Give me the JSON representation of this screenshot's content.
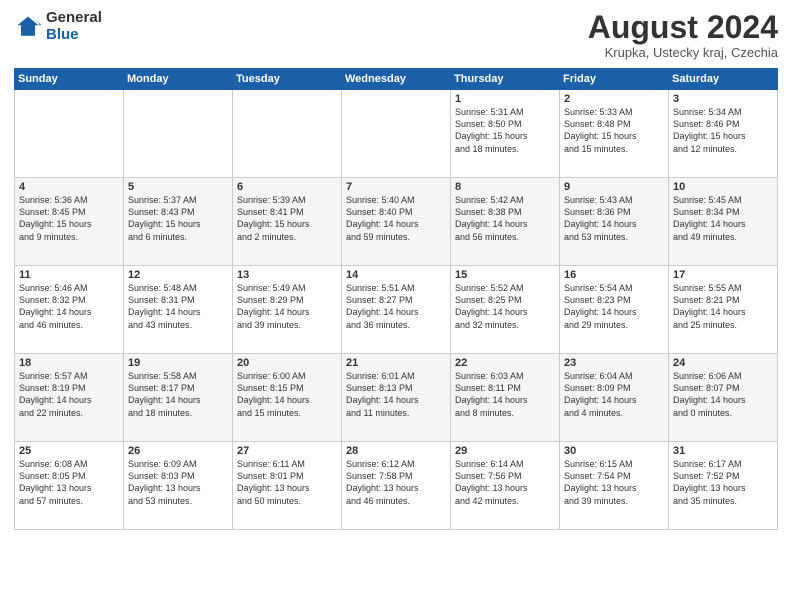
{
  "logo": {
    "general": "General",
    "blue": "Blue"
  },
  "header": {
    "title": "August 2024",
    "subtitle": "Krupka, Ustecky kraj, Czechia"
  },
  "weekdays": [
    "Sunday",
    "Monday",
    "Tuesday",
    "Wednesday",
    "Thursday",
    "Friday",
    "Saturday"
  ],
  "weeks": [
    [
      {
        "day": "",
        "info": ""
      },
      {
        "day": "",
        "info": ""
      },
      {
        "day": "",
        "info": ""
      },
      {
        "day": "",
        "info": ""
      },
      {
        "day": "1",
        "info": "Sunrise: 5:31 AM\nSunset: 8:50 PM\nDaylight: 15 hours\nand 18 minutes."
      },
      {
        "day": "2",
        "info": "Sunrise: 5:33 AM\nSunset: 8:48 PM\nDaylight: 15 hours\nand 15 minutes."
      },
      {
        "day": "3",
        "info": "Sunrise: 5:34 AM\nSunset: 8:46 PM\nDaylight: 15 hours\nand 12 minutes."
      }
    ],
    [
      {
        "day": "4",
        "info": "Sunrise: 5:36 AM\nSunset: 8:45 PM\nDaylight: 15 hours\nand 9 minutes."
      },
      {
        "day": "5",
        "info": "Sunrise: 5:37 AM\nSunset: 8:43 PM\nDaylight: 15 hours\nand 6 minutes."
      },
      {
        "day": "6",
        "info": "Sunrise: 5:39 AM\nSunset: 8:41 PM\nDaylight: 15 hours\nand 2 minutes."
      },
      {
        "day": "7",
        "info": "Sunrise: 5:40 AM\nSunset: 8:40 PM\nDaylight: 14 hours\nand 59 minutes."
      },
      {
        "day": "8",
        "info": "Sunrise: 5:42 AM\nSunset: 8:38 PM\nDaylight: 14 hours\nand 56 minutes."
      },
      {
        "day": "9",
        "info": "Sunrise: 5:43 AM\nSunset: 8:36 PM\nDaylight: 14 hours\nand 53 minutes."
      },
      {
        "day": "10",
        "info": "Sunrise: 5:45 AM\nSunset: 8:34 PM\nDaylight: 14 hours\nand 49 minutes."
      }
    ],
    [
      {
        "day": "11",
        "info": "Sunrise: 5:46 AM\nSunset: 8:32 PM\nDaylight: 14 hours\nand 46 minutes."
      },
      {
        "day": "12",
        "info": "Sunrise: 5:48 AM\nSunset: 8:31 PM\nDaylight: 14 hours\nand 43 minutes."
      },
      {
        "day": "13",
        "info": "Sunrise: 5:49 AM\nSunset: 8:29 PM\nDaylight: 14 hours\nand 39 minutes."
      },
      {
        "day": "14",
        "info": "Sunrise: 5:51 AM\nSunset: 8:27 PM\nDaylight: 14 hours\nand 36 minutes."
      },
      {
        "day": "15",
        "info": "Sunrise: 5:52 AM\nSunset: 8:25 PM\nDaylight: 14 hours\nand 32 minutes."
      },
      {
        "day": "16",
        "info": "Sunrise: 5:54 AM\nSunset: 8:23 PM\nDaylight: 14 hours\nand 29 minutes."
      },
      {
        "day": "17",
        "info": "Sunrise: 5:55 AM\nSunset: 8:21 PM\nDaylight: 14 hours\nand 25 minutes."
      }
    ],
    [
      {
        "day": "18",
        "info": "Sunrise: 5:57 AM\nSunset: 8:19 PM\nDaylight: 14 hours\nand 22 minutes."
      },
      {
        "day": "19",
        "info": "Sunrise: 5:58 AM\nSunset: 8:17 PM\nDaylight: 14 hours\nand 18 minutes."
      },
      {
        "day": "20",
        "info": "Sunrise: 6:00 AM\nSunset: 8:15 PM\nDaylight: 14 hours\nand 15 minutes."
      },
      {
        "day": "21",
        "info": "Sunrise: 6:01 AM\nSunset: 8:13 PM\nDaylight: 14 hours\nand 11 minutes."
      },
      {
        "day": "22",
        "info": "Sunrise: 6:03 AM\nSunset: 8:11 PM\nDaylight: 14 hours\nand 8 minutes."
      },
      {
        "day": "23",
        "info": "Sunrise: 6:04 AM\nSunset: 8:09 PM\nDaylight: 14 hours\nand 4 minutes."
      },
      {
        "day": "24",
        "info": "Sunrise: 6:06 AM\nSunset: 8:07 PM\nDaylight: 14 hours\nand 0 minutes."
      }
    ],
    [
      {
        "day": "25",
        "info": "Sunrise: 6:08 AM\nSunset: 8:05 PM\nDaylight: 13 hours\nand 57 minutes."
      },
      {
        "day": "26",
        "info": "Sunrise: 6:09 AM\nSunset: 8:03 PM\nDaylight: 13 hours\nand 53 minutes."
      },
      {
        "day": "27",
        "info": "Sunrise: 6:11 AM\nSunset: 8:01 PM\nDaylight: 13 hours\nand 50 minutes."
      },
      {
        "day": "28",
        "info": "Sunrise: 6:12 AM\nSunset: 7:58 PM\nDaylight: 13 hours\nand 46 minutes."
      },
      {
        "day": "29",
        "info": "Sunrise: 6:14 AM\nSunset: 7:56 PM\nDaylight: 13 hours\nand 42 minutes."
      },
      {
        "day": "30",
        "info": "Sunrise: 6:15 AM\nSunset: 7:54 PM\nDaylight: 13 hours\nand 39 minutes."
      },
      {
        "day": "31",
        "info": "Sunrise: 6:17 AM\nSunset: 7:52 PM\nDaylight: 13 hours\nand 35 minutes."
      }
    ]
  ]
}
